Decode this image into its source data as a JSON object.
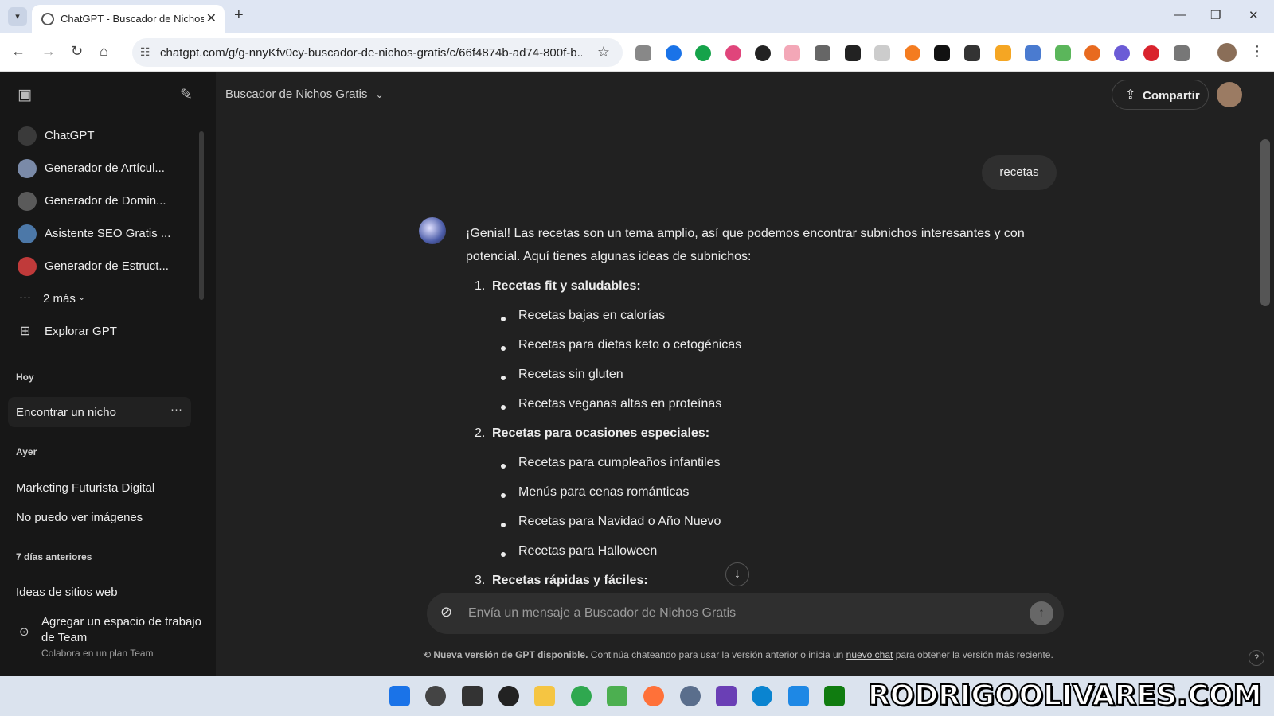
{
  "browser": {
    "tab_title": "ChatGPT - Buscador de Nichos",
    "url": "chatgpt.com/g/g-nnyKfv0cy-buscador-de-nichos-gratis/c/66f4874b-ad74-800f-b..."
  },
  "sidebar": {
    "gpts": [
      {
        "label": "ChatGPT",
        "icon": "chatgpt-icon",
        "color": "#3a3a3a"
      },
      {
        "label": "Generador de Artícul...",
        "icon": "gpt-avatar",
        "color": "#7a8aa8"
      },
      {
        "label": "Generador de Domin...",
        "icon": "gpt-avatar",
        "color": "#5a5a5a"
      },
      {
        "label": "Asistente SEO Gratis ...",
        "icon": "gpt-avatar",
        "color": "#4c78a8"
      },
      {
        "label": "Generador de Estruct...",
        "icon": "gpt-avatar",
        "color": "#c03a3a"
      }
    ],
    "more_label": "2 más",
    "explore_label": "Explorar GPT",
    "sections": {
      "today": "Hoy",
      "yesterday": "Ayer",
      "last7": "7 días anteriores"
    },
    "today_items": [
      "Encontrar un nicho"
    ],
    "yesterday_items": [
      "Marketing Futurista Digital",
      "No puedo ver imágenes"
    ],
    "last7_items": [
      "Ideas de sitios web"
    ],
    "team": {
      "title_line1": "Agregar un espacio de trabajo",
      "title_line2": "de Team",
      "subtitle": "Colabora en un plan Team"
    }
  },
  "header": {
    "gpt_name": "Buscador de Nichos Gratis",
    "share_label": "Compartir"
  },
  "conversation": {
    "user_message": "recetas",
    "intro_line1": "¡Genial! Las recetas son un tema amplio, así que podemos encontrar subnichos interesantes y con",
    "intro_line2": "potencial. Aquí tienes algunas ideas de subnichos:",
    "sections": [
      {
        "number": "1.",
        "title": "Recetas fit y saludables",
        "items": [
          "Recetas bajas en calorías",
          "Recetas para dietas keto o cetogénicas",
          "Recetas sin gluten",
          "Recetas veganas altas en proteínas"
        ]
      },
      {
        "number": "2.",
        "title": "Recetas para ocasiones especiales",
        "items": [
          "Recetas para cumpleaños infantiles",
          "Menús para cenas románticas",
          "Recetas para Navidad o Año Nuevo",
          "Recetas para Halloween"
        ]
      },
      {
        "number": "3.",
        "title": "Recetas rápidas y fáciles",
        "items": []
      }
    ]
  },
  "composer": {
    "placeholder": "Envía un mensaje a Buscador de Nichos Gratis"
  },
  "notice": {
    "bold": "Nueva versión de GPT disponible.",
    "text_before": " Continúa chateando para usar la versión anterior o inicia un ",
    "link": "nuevo chat",
    "text_after": " para obtener la versión más reciente."
  },
  "help": "?",
  "watermark": "RODRIGOOLIVARES.COM"
}
